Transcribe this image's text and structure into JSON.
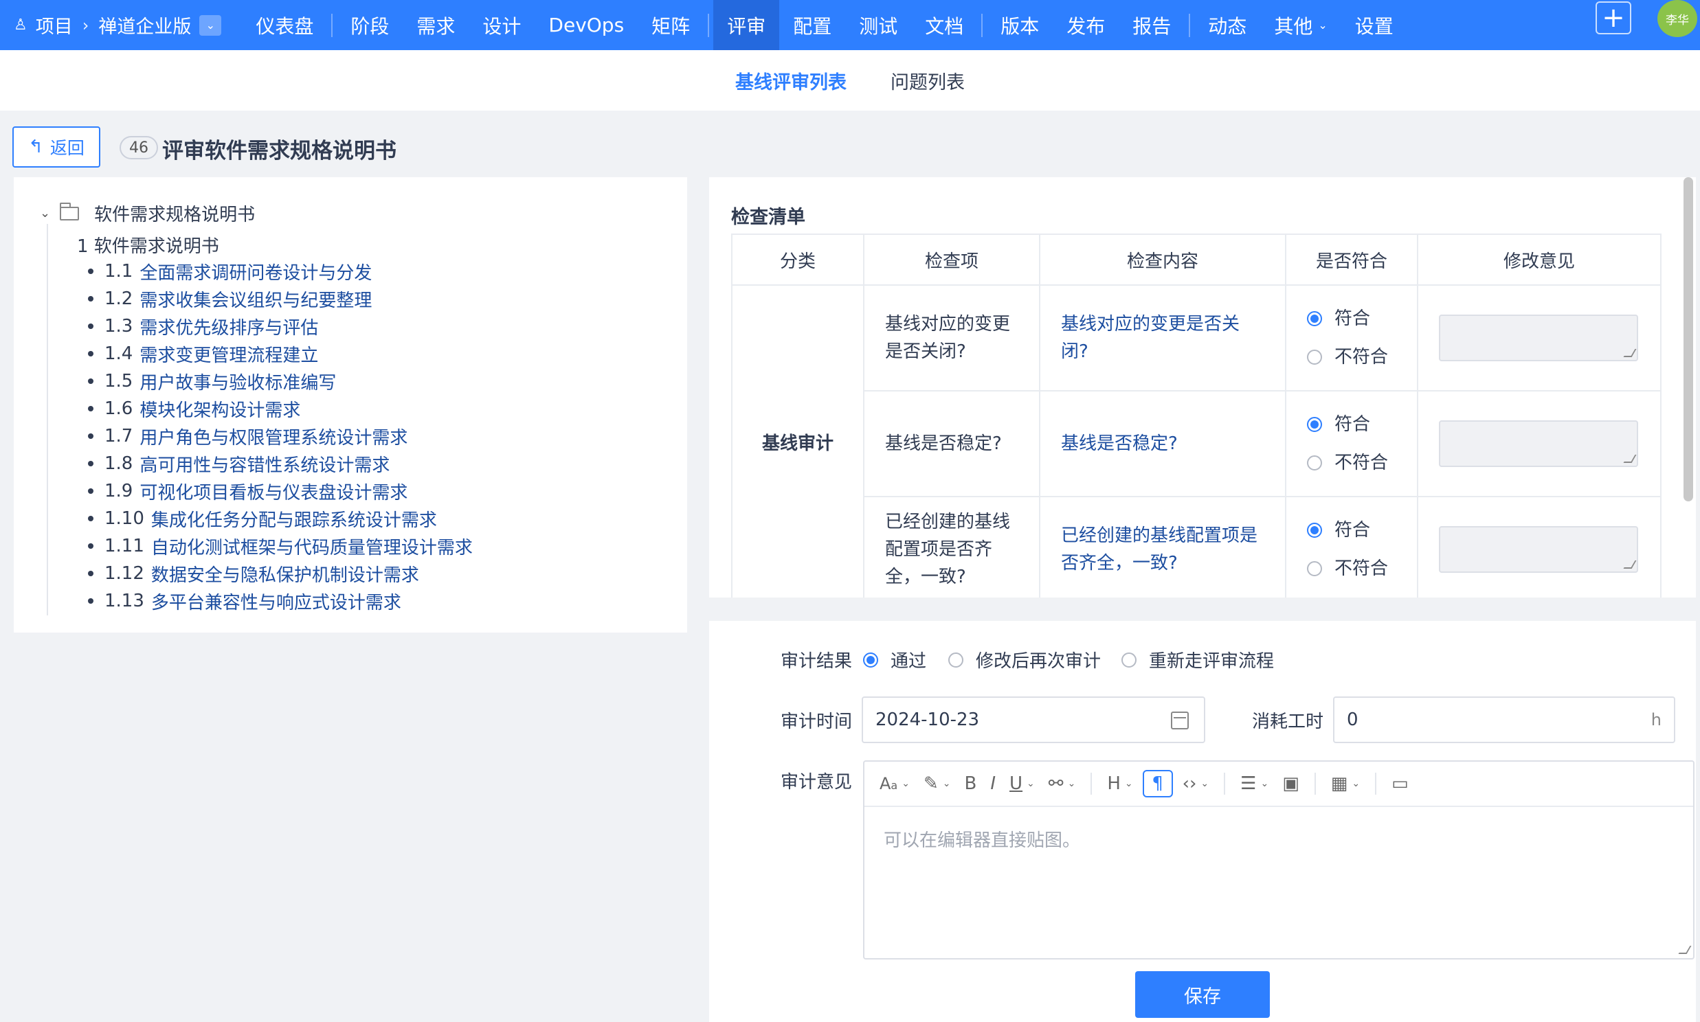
{
  "topnav": {
    "crumb_project": "项目",
    "crumb_product": "禅道企业版",
    "items": [
      "仪表盘",
      "阶段",
      "需求",
      "设计",
      "DevOps",
      "矩阵",
      "评审",
      "配置",
      "测试",
      "文档",
      "版本",
      "发布",
      "报告",
      "动态",
      "其他",
      "设置"
    ],
    "active_index": 6,
    "user_name": "李华",
    "accent_color": "#2e7fff",
    "avatar_color": "#8bc34a"
  },
  "subnav": {
    "tabs": [
      "基线评审列表",
      "问题列表"
    ],
    "active_index": 0
  },
  "header": {
    "back_label": "返回",
    "id": "46",
    "title": "评审软件需求规格说明书"
  },
  "tree": {
    "root": "软件需求规格说明书",
    "section": "1 软件需求说明书",
    "items": [
      {
        "num": "1.1",
        "label": "全面需求调研问卷设计与分发"
      },
      {
        "num": "1.2",
        "label": "需求收集会议组织与纪要整理"
      },
      {
        "num": "1.3",
        "label": "需求优先级排序与评估"
      },
      {
        "num": "1.4",
        "label": "需求变更管理流程建立"
      },
      {
        "num": "1.5",
        "label": "用户故事与验收标准编写"
      },
      {
        "num": "1.6",
        "label": "模块化架构设计需求"
      },
      {
        "num": "1.7",
        "label": "用户角色与权限管理系统设计需求"
      },
      {
        "num": "1.8",
        "label": "高可用性与容错性系统设计需求"
      },
      {
        "num": "1.9",
        "label": "可视化项目看板与仪表盘设计需求"
      },
      {
        "num": "1.10",
        "label": "集成化任务分配与跟踪系统设计需求"
      },
      {
        "num": "1.11",
        "label": "自动化测试框架与代码质量管理设计需求"
      },
      {
        "num": "1.12",
        "label": "数据安全与隐私保护机制设计需求"
      },
      {
        "num": "1.13",
        "label": "多平台兼容性与响应式设计需求"
      }
    ]
  },
  "checklist": {
    "title": "检查清单",
    "headers": [
      "分类",
      "检查项",
      "检查内容",
      "是否符合",
      "修改意见"
    ],
    "category": "基线审计",
    "option_yes": "符合",
    "option_no": "不符合",
    "rows": [
      {
        "item": "基线对应的变更是否关闭?",
        "content": "基线对应的变更是否关闭?",
        "selected": "符合"
      },
      {
        "item": "基线是否稳定?",
        "content": "基线是否稳定?",
        "selected": "符合"
      },
      {
        "item": "已经创建的基线配置项是否齐全，一致?",
        "content": "已经创建的基线配置项是否齐全，一致?",
        "selected": "符合"
      }
    ]
  },
  "audit": {
    "result_label": "审计结果",
    "result_options": [
      "通过",
      "修改后再次审计",
      "重新走评审流程"
    ],
    "result_selected": 0,
    "time_label": "审计时间",
    "time_value": "2024-10-23",
    "hours_label": "消耗工时",
    "hours_value": "0",
    "hours_unit": "h",
    "opinion_label": "审计意见",
    "editor_placeholder": "可以在编辑器直接贴图。",
    "save_label": "保存"
  }
}
